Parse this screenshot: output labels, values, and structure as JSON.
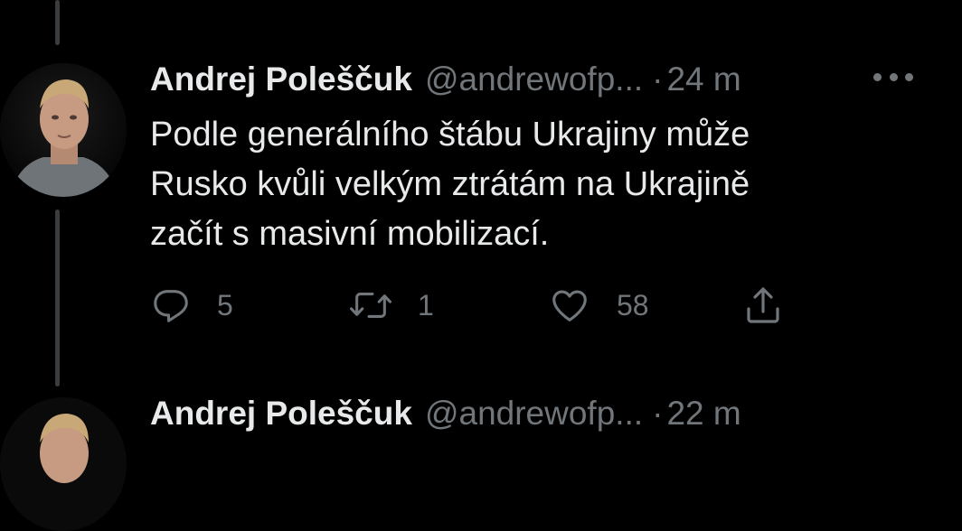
{
  "tweets": [
    {
      "display_name": "Andrej Poleščuk",
      "handle": "@andrewofp...",
      "separator": "·",
      "time": "24 m",
      "text_lines": [
        "Podle generálního štábu Ukrajiny může",
        "Rusko kvůli velkým ztrátám na Ukrajině",
        "začít s masivní mobilizací."
      ],
      "counts": {
        "replies": "5",
        "retweets": "1",
        "likes": "58"
      },
      "icons": [
        "reply-icon",
        "retweet-icon",
        "like-icon",
        "share-icon",
        "more-icon"
      ]
    },
    {
      "display_name": "Andrej Poleščuk",
      "handle": "@andrewofp...",
      "separator": "·",
      "time": "22 m"
    }
  ],
  "colors": {
    "background": "#000000",
    "primary_text": "#e7e9ea",
    "secondary_text": "#71767b",
    "thread_line": "#3a3d40"
  }
}
